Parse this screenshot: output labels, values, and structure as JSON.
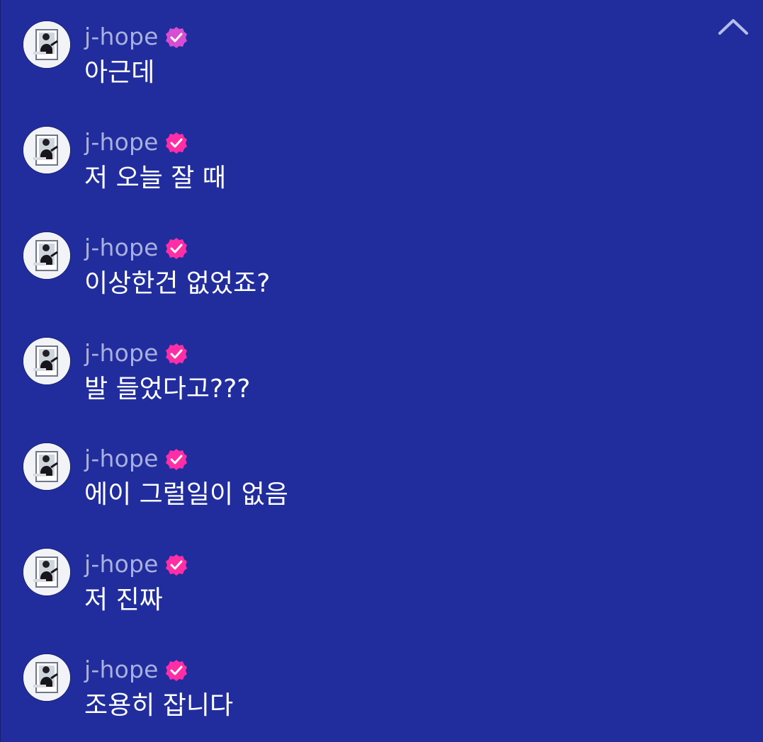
{
  "chat": {
    "collapse_icon": "chevron-up-icon",
    "verified_icon": "verified-badge-icon",
    "accent_badge_color": "#ff2ea6",
    "messages": [
      {
        "username": "j-hope",
        "text": "아근데"
      },
      {
        "username": "j-hope",
        "text": "저 오늘 잘 때"
      },
      {
        "username": "j-hope",
        "text": "이상한건 없었죠?"
      },
      {
        "username": "j-hope",
        "text": "발 들었다고???"
      },
      {
        "username": "j-hope",
        "text": "에이 그럴일이 없음"
      },
      {
        "username": "j-hope",
        "text": "저 진짜"
      },
      {
        "username": "j-hope",
        "text": "조용히 잡니다"
      }
    ]
  }
}
